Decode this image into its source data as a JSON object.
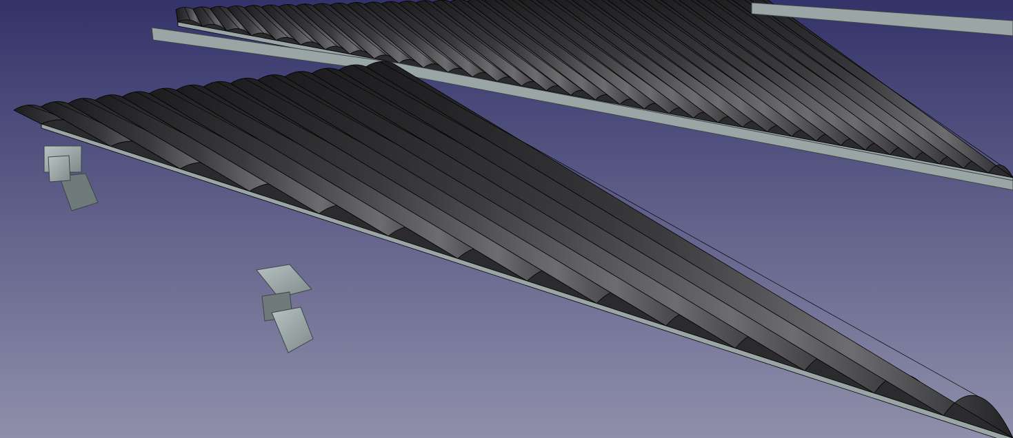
{
  "app": {
    "title": ""
  },
  "viewport": {
    "description_visible_text": [],
    "background": {
      "top_color": "#33336a",
      "bottom_color": "#8f8fab"
    },
    "materials": {
      "sheet_dark": "#2b2b2d",
      "sheet_light": "#6a6a6e",
      "steel_face": "#9aa5a5",
      "steel_edge": "#6f7a7a",
      "edge_line": "#000000"
    },
    "objects": [
      {
        "name": "corrugated-sheet-front",
        "type": "corrugated roof sheet"
      },
      {
        "name": "corrugated-sheet-back",
        "type": "corrugated roof sheet"
      },
      {
        "name": "steel-purlin-left",
        "type": "I-beam support"
      },
      {
        "name": "steel-purlin-middle",
        "type": "I-beam support"
      },
      {
        "name": "steel-channel-top",
        "type": "channel profile"
      }
    ]
  }
}
